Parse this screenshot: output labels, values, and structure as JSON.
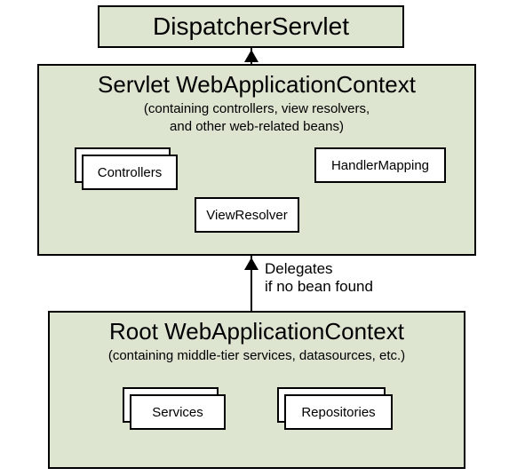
{
  "dispatcher": {
    "title": "DispatcherServlet"
  },
  "servletContext": {
    "title": "Servlet WebApplicationContext",
    "subtitle1": "(containing controllers, view resolvers,",
    "subtitle2": "and other web-related beans)",
    "controllers": "Controllers",
    "viewResolver": "ViewResolver",
    "handlerMapping": "HandlerMapping"
  },
  "rootContext": {
    "title": "Root WebApplicationContext",
    "subtitle": "(containing middle-tier services, datasources, etc.)",
    "services": "Services",
    "repositories": "Repositories"
  },
  "arrowLabel": "Delegates if no bean found"
}
